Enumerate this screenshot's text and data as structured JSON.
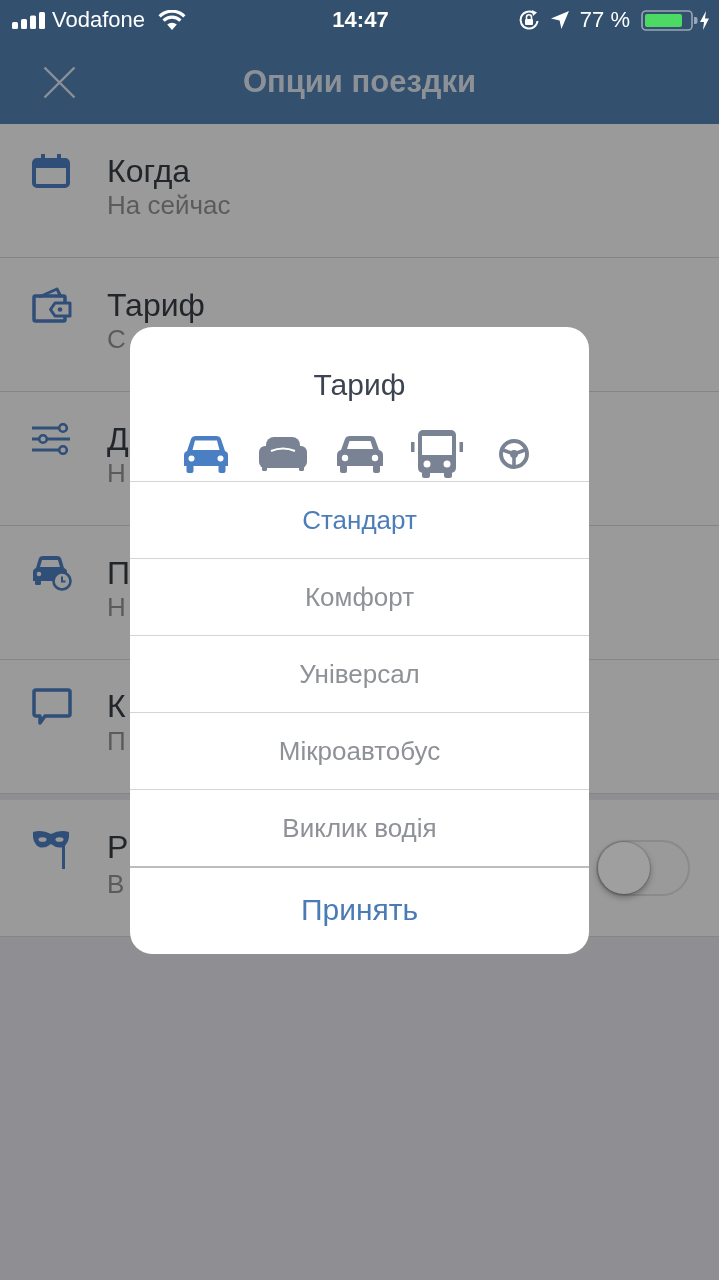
{
  "status_bar": {
    "carrier": "Vodafone",
    "time": "14:47",
    "battery_percent": "77 %"
  },
  "nav_bar": {
    "title": "Опции поездки"
  },
  "sections": [
    {
      "rows": [
        {
          "title": "Когда",
          "subtitle": "На сейчас"
        },
        {
          "title": "Тариф",
          "subtitle": "С"
        },
        {
          "title": "Д",
          "subtitle": "Н"
        },
        {
          "title": "П",
          "subtitle": "Н"
        },
        {
          "title": "К",
          "subtitle": "П"
        }
      ]
    },
    {
      "rows": [
        {
          "title": "Р",
          "subtitle": "В",
          "toggle": {
            "on": false
          }
        }
      ]
    }
  ],
  "dialog": {
    "title": "Тариф",
    "tariffs": [
      {
        "label": "Стандарт",
        "selected": true
      },
      {
        "label": "Комфорт",
        "selected": false
      },
      {
        "label": "Універсал",
        "selected": false
      },
      {
        "label": "Мікроавтобус",
        "selected": false
      },
      {
        "label": "Виклик водія",
        "selected": false
      }
    ],
    "confirm_button": "Принять"
  }
}
